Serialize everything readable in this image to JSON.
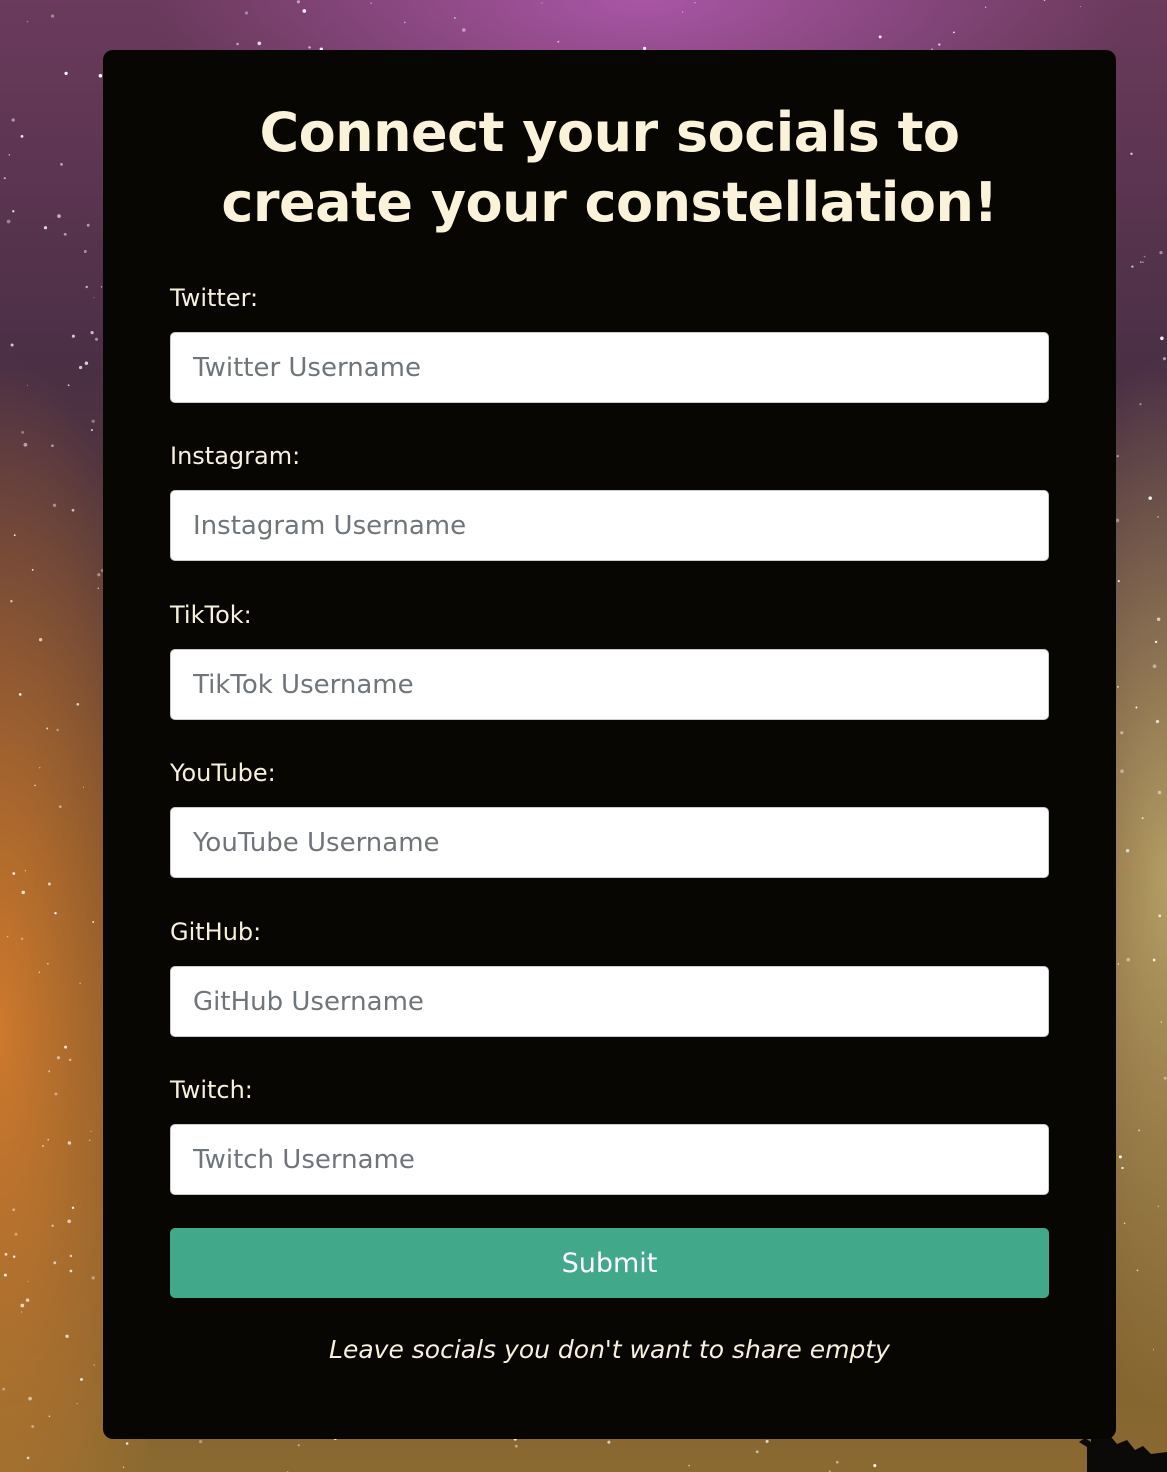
{
  "title": "Connect your socials to create your constellation!",
  "fields": [
    {
      "label": "Twitter:",
      "placeholder": "Twitter Username",
      "value": ""
    },
    {
      "label": "Instagram:",
      "placeholder": "Instagram Username",
      "value": ""
    },
    {
      "label": "TikTok:",
      "placeholder": "TikTok Username",
      "value": ""
    },
    {
      "label": "YouTube:",
      "placeholder": "YouTube Username",
      "value": ""
    },
    {
      "label": "GitHub:",
      "placeholder": "GitHub Username",
      "value": ""
    },
    {
      "label": "Twitch:",
      "placeholder": "Twitch Username",
      "value": ""
    }
  ],
  "submit_label": "Submit",
  "footnote": "Leave socials you don't want to share empty",
  "colors": {
    "card_background": "#070602",
    "title_text": "#fbf3d9",
    "submit_button": "#41a98a",
    "input_background": "#ffffff"
  },
  "background": "starry-night-sky"
}
